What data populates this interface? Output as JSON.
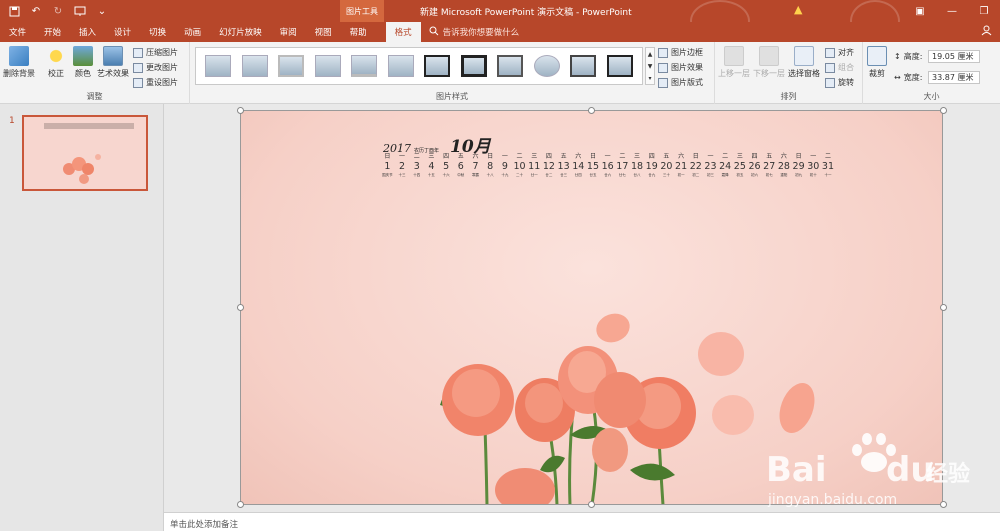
{
  "quick_access": {
    "save_icon": "save-icon",
    "undo_icon": "undo-icon",
    "redo_icon": "redo-icon",
    "present_icon": "present-icon",
    "more_icon": "chevron-down-icon"
  },
  "title": {
    "context_group": "图片工具",
    "document_title": "新建 Microsoft PowerPoint 演示文稿 - PowerPoint",
    "warning_icon": "warning-icon"
  },
  "window_controls": {
    "ribbon_display": "▣",
    "minimize": "—",
    "maximize": "❐"
  },
  "tabs": [
    {
      "label": "文件"
    },
    {
      "label": "开始"
    },
    {
      "label": "插入"
    },
    {
      "label": "设计"
    },
    {
      "label": "切换"
    },
    {
      "label": "动画"
    },
    {
      "label": "幻灯片放映"
    },
    {
      "label": "审阅"
    },
    {
      "label": "视图"
    },
    {
      "label": "帮助"
    },
    {
      "label": "格式"
    }
  ],
  "tell_me": {
    "text": "告诉我你想要做什么"
  },
  "ribbon": {
    "adjust": {
      "remove_bg": "删除背景",
      "correct": "校正",
      "color": "颜色",
      "art_effects": "艺术效果",
      "compress": "压缩图片",
      "change": "更改图片",
      "reset": "重设图片",
      "label": "调整"
    },
    "styles": {
      "label": "图片样式",
      "border": "图片边框",
      "effects": "图片效果",
      "layout": "图片版式"
    },
    "arrange": {
      "label": "排列",
      "bring_forward": "上移一层",
      "send_backward": "下移一层",
      "selection_pane": "选择窗格",
      "align": "对齐",
      "group": "组合",
      "rotate": "旋转"
    },
    "size": {
      "label": "大小",
      "crop": "裁剪",
      "height_label": "高度:",
      "height_value": "19.05 厘米",
      "width_label": "宽度:",
      "width_value": "33.87 厘米"
    }
  },
  "slide_panel": {
    "slide_number": "1"
  },
  "slide": {
    "calendar": {
      "year": "2017",
      "year_sub": "农历丁酉年",
      "month": "10月",
      "weekdays": [
        "日",
        "一",
        "二",
        "三",
        "四",
        "五",
        "六",
        "日",
        "一",
        "二",
        "三",
        "四",
        "五",
        "六",
        "日",
        "一",
        "二",
        "三",
        "四",
        "五",
        "六",
        "日",
        "一",
        "二",
        "三",
        "四",
        "五",
        "六",
        "日",
        "一",
        "二"
      ],
      "days": [
        "1",
        "2",
        "3",
        "4",
        "5",
        "6",
        "7",
        "8",
        "9",
        "10",
        "11",
        "12",
        "13",
        "14",
        "15",
        "16",
        "17",
        "18",
        "19",
        "20",
        "21",
        "22",
        "23",
        "24",
        "25",
        "26",
        "27",
        "28",
        "29",
        "30",
        "31"
      ],
      "lunar": [
        "国庆节",
        "十三",
        "十四",
        "十五",
        "十六",
        "中秋",
        "寒露",
        "十八",
        "十九",
        "二十",
        "廿一",
        "廿二",
        "廿三",
        "廿四",
        "廿五",
        "廿六",
        "廿七",
        "廿八",
        "廿九",
        "三十",
        "初一",
        "初二",
        "初三",
        "霜降",
        "初五",
        "初六",
        "初七",
        "重阳",
        "初九",
        "初十",
        "十一"
      ]
    }
  },
  "notes": {
    "placeholder": "单击此处添加备注"
  },
  "watermark": {
    "brand": "Bai",
    "brand2": "du",
    "brand_cn": "经验",
    "url": "jingyan.baidu.com"
  }
}
